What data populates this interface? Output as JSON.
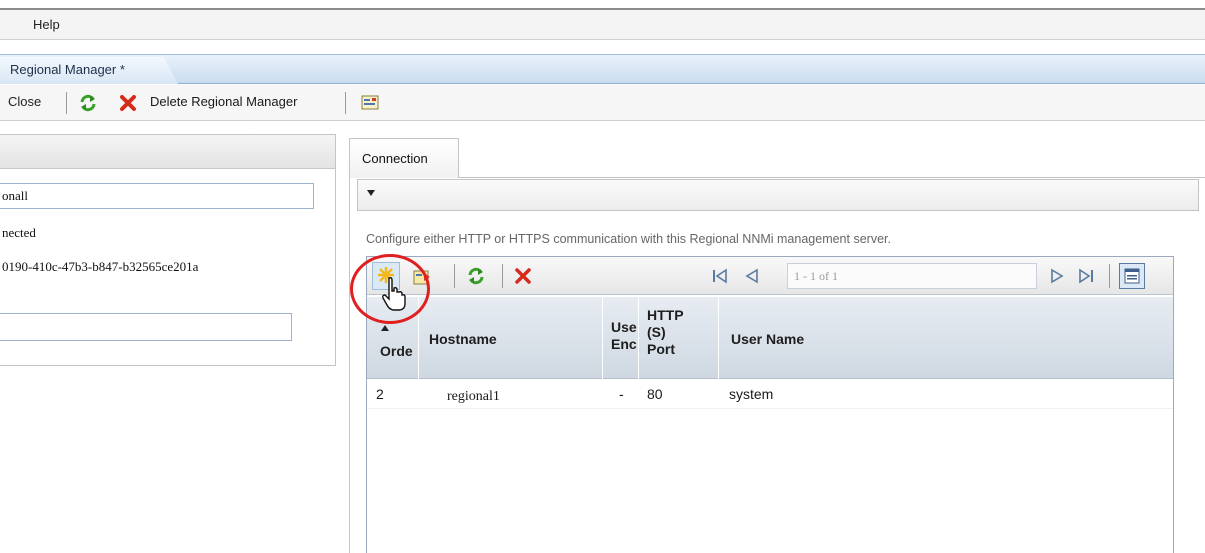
{
  "menu": {
    "help_label": "Help"
  },
  "document_tab": {
    "label": "Regional Manager *"
  },
  "toolbar": {
    "close_label": "Close",
    "delete_label": "Delete Regional Manager",
    "icons": [
      "refresh-icon",
      "delete-icon",
      "form-view-icon"
    ]
  },
  "left_panel": {
    "name_value": "onall",
    "status_text": "nected",
    "uuid_text": "0190-410c-47b3-b847-b32565ce201a",
    "empty_field_value": ""
  },
  "connection_tab": {
    "label": "Connection",
    "description": "Configure either HTTP or HTTPS communication with this Regional NNMi management server.",
    "pager_text": "1 - 1 of 1",
    "columns": [
      "Orde",
      "Hostname",
      "Use Enc",
      "HTTP (S) Port",
      "User Name"
    ],
    "rows": [
      {
        "order": "2",
        "hostname": "regional1",
        "use_enc": "-",
        "port": "80",
        "user_name": "system"
      }
    ]
  },
  "colors": {
    "tab_strip": "#c9dcef",
    "grid_header": "#cfd8e2",
    "cursor_circle": "#e02020"
  }
}
